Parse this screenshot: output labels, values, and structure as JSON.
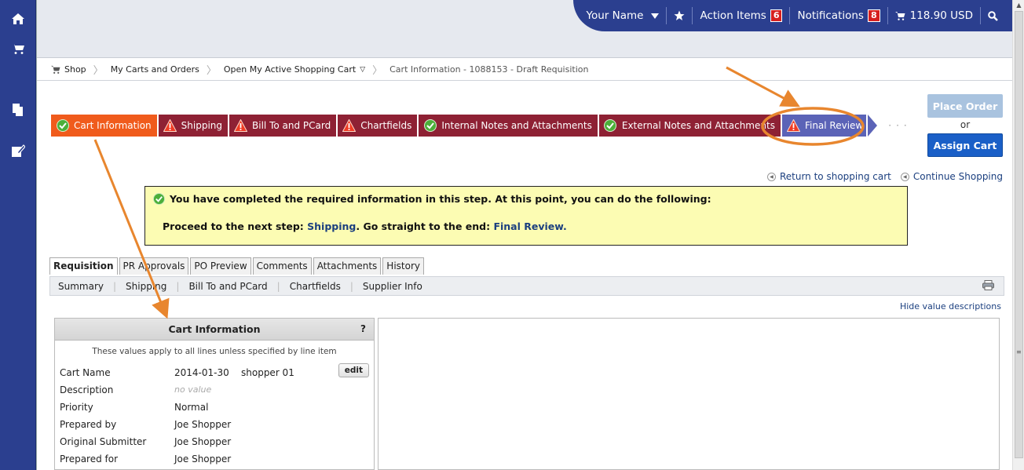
{
  "header": {
    "user_name": "Your Name",
    "action_items_label": "Action Items",
    "action_items_count": "6",
    "notifications_label": "Notifications",
    "notifications_count": "8",
    "cart_total": "118.90 USD"
  },
  "breadcrumb": {
    "shop": "Shop",
    "carts": "My Carts and Orders",
    "open_cart": "Open My Active Shopping Cart",
    "current": "Cart Information - 1088153 - Draft Requisition"
  },
  "steps": [
    {
      "label": "Cart Information",
      "status": "complete"
    },
    {
      "label": "Shipping",
      "status": "warning"
    },
    {
      "label": "Bill To and PCard",
      "status": "warning"
    },
    {
      "label": "Chartfields",
      "status": "warning"
    },
    {
      "label": "Internal Notes and Attachments",
      "status": "complete"
    },
    {
      "label": "External Notes and Attachments",
      "status": "complete"
    },
    {
      "label": "Final Review",
      "status": "warning"
    }
  ],
  "actions": {
    "place_order": "Place Order",
    "or": "or",
    "assign_cart": "Assign Cart",
    "return_link": "Return to shopping cart",
    "continue_link": "Continue Shopping"
  },
  "notice": {
    "line1": "You have completed the required information in this step. At this point, you can do the following:",
    "proceed_prefix": "Proceed to the next step: ",
    "proceed_link": "Shipping",
    "end_prefix": ". Go straight to the end: ",
    "end_link": "Final Review",
    "end_suffix": "."
  },
  "tabs": [
    "Requisition",
    "PR Approvals",
    "PO Preview",
    "Comments",
    "Attachments",
    "History"
  ],
  "subtabs": [
    "Summary",
    "Shipping",
    "Bill To and PCard",
    "Chartfields",
    "Supplier Info"
  ],
  "hide_values": "Hide value descriptions",
  "cart_panel": {
    "title": "Cart Information",
    "help": "?",
    "note": "These values apply to all lines unless specified by line item",
    "edit": "edit",
    "rows": [
      {
        "label": "Cart Name",
        "value": "2014-01-30    shopper 01"
      },
      {
        "label": "Description",
        "value": "no value"
      },
      {
        "label": "Priority",
        "value": "Normal"
      },
      {
        "label": "Prepared by",
        "value": "Joe Shopper"
      },
      {
        "label": "Original Submitter",
        "value": "Joe Shopper"
      },
      {
        "label": "Prepared for",
        "value": "Joe Shopper"
      }
    ]
  },
  "colors": {
    "nav": "#2b3f8f",
    "step_active": "#f05b1c",
    "step_default": "#8e2134",
    "step_review": "#5b63b7",
    "notice_bg": "#fcfcb3",
    "annotation": "#e8862e"
  }
}
